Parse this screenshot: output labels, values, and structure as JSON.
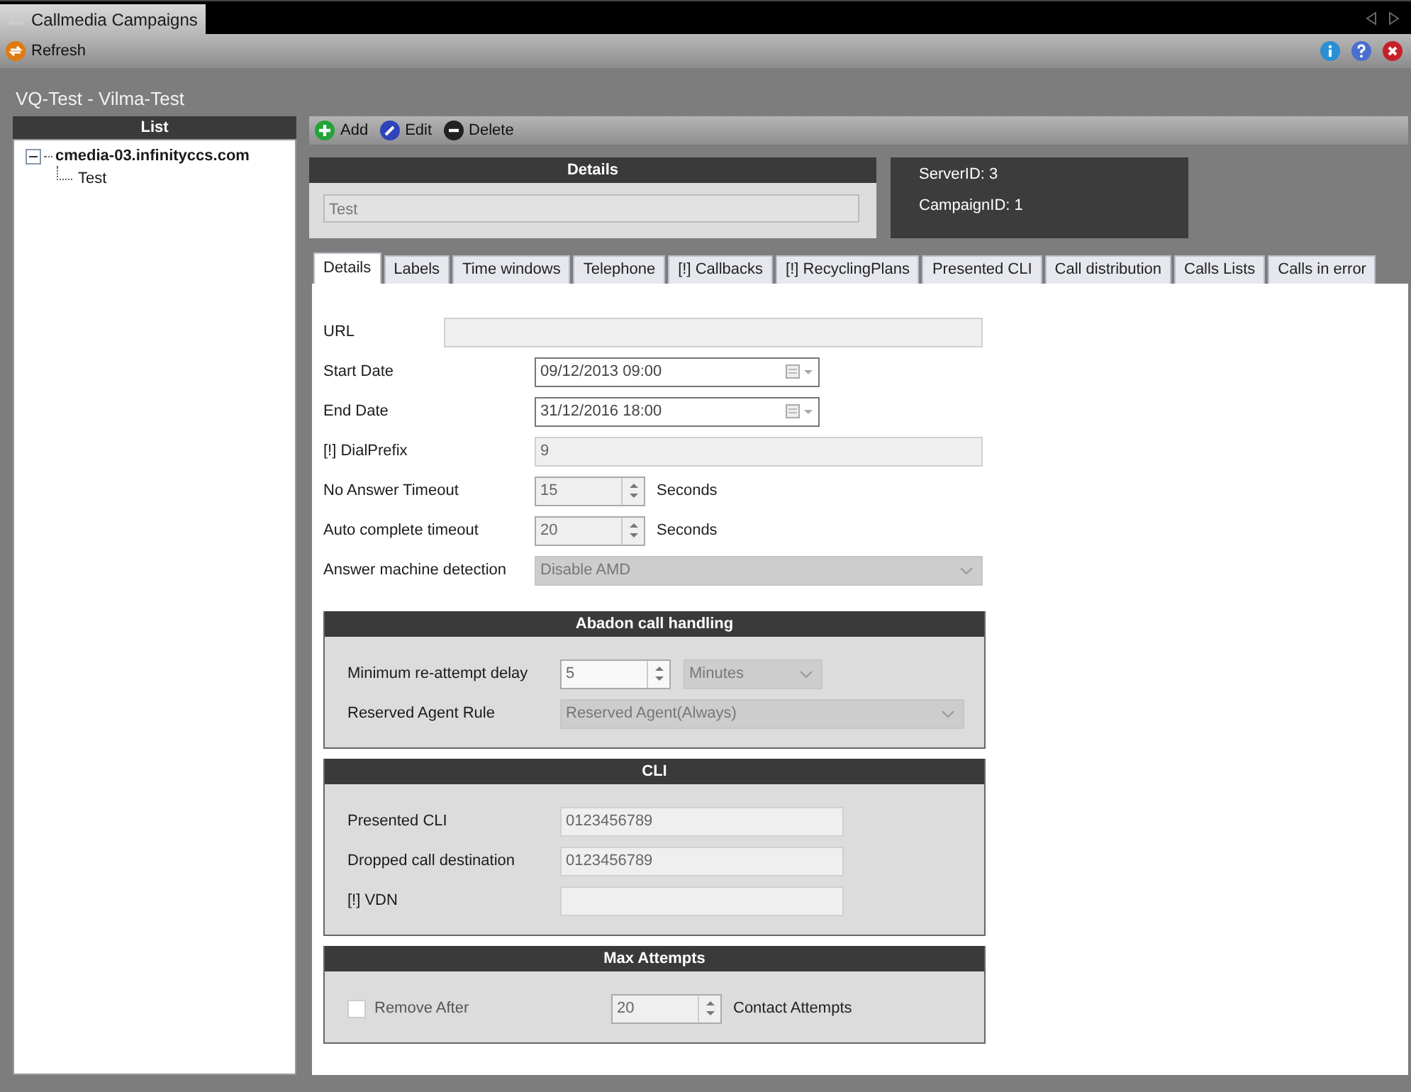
{
  "app_tab": {
    "title": "Callmedia Campaigns"
  },
  "toolbar": {
    "refresh": "Refresh"
  },
  "page_title": "VQ-Test - Vilma-Test",
  "list_panel": {
    "header": "List",
    "tree": [
      {
        "label": "cmedia-03.infinityccs.com",
        "expanded": true,
        "children": [
          {
            "label": "Test"
          }
        ]
      }
    ]
  },
  "actions": [
    {
      "kind": "add",
      "label": "Add"
    },
    {
      "kind": "edit",
      "label": "Edit"
    },
    {
      "kind": "delete",
      "label": "Delete"
    }
  ],
  "details": {
    "header": "Details",
    "name": "Test"
  },
  "info": [
    "ServerID: 3",
    "CampaignID: 1"
  ],
  "tabs": [
    {
      "label": "Details",
      "selected": true
    },
    {
      "label": "Labels",
      "selected": false
    },
    {
      "label": "Time windows",
      "selected": false
    },
    {
      "label": "Telephone",
      "selected": false
    },
    {
      "label": "[!] Callbacks",
      "selected": false
    },
    {
      "label": "[!] RecyclingPlans",
      "selected": false
    },
    {
      "label": "Presented CLI",
      "selected": false
    },
    {
      "label": "Call distribution",
      "selected": false
    },
    {
      "label": "Calls Lists",
      "selected": false
    },
    {
      "label": "Calls in error",
      "selected": false
    }
  ],
  "fields": [
    {
      "kind": "wide-text",
      "label": "URL"
    },
    {
      "kind": "date",
      "label": "Start Date",
      "value": "09/12/2013 09:00"
    },
    {
      "kind": "date",
      "label": "End Date",
      "value": "31/12/2016 18:00"
    },
    {
      "kind": "text",
      "label": "[!] DialPrefix",
      "value": "9"
    },
    {
      "kind": "spin",
      "label": "No Answer Timeout",
      "value": "15",
      "unit": "Seconds"
    },
    {
      "kind": "spin",
      "label": "Auto complete timeout",
      "value": "20",
      "unit": "Seconds"
    },
    {
      "kind": "select",
      "label": "Answer machine detection",
      "value": "Disable AMD"
    }
  ],
  "groups": [
    {
      "title": "Abadon call handling",
      "rows": [
        {
          "kind": "spin-select",
          "label": "Minimum re-attempt delay",
          "value": "5",
          "unit": "Minutes"
        },
        {
          "kind": "select",
          "label": "Reserved Agent Rule",
          "value": "Reserved Agent(Always)"
        }
      ]
    },
    {
      "title": "CLI",
      "rows": [
        {
          "kind": "text",
          "label": "Presented CLI",
          "value": "0123456789"
        },
        {
          "kind": "text",
          "label": "Dropped call destination",
          "value": "0123456789"
        },
        {
          "kind": "text",
          "label": "[!] VDN"
        }
      ]
    },
    {
      "title": "Max Attempts",
      "rows": [
        {
          "kind": "check-spin",
          "label": "Remove After",
          "checked": false,
          "value": "20",
          "unit": "Contact Attempts"
        }
      ]
    }
  ]
}
